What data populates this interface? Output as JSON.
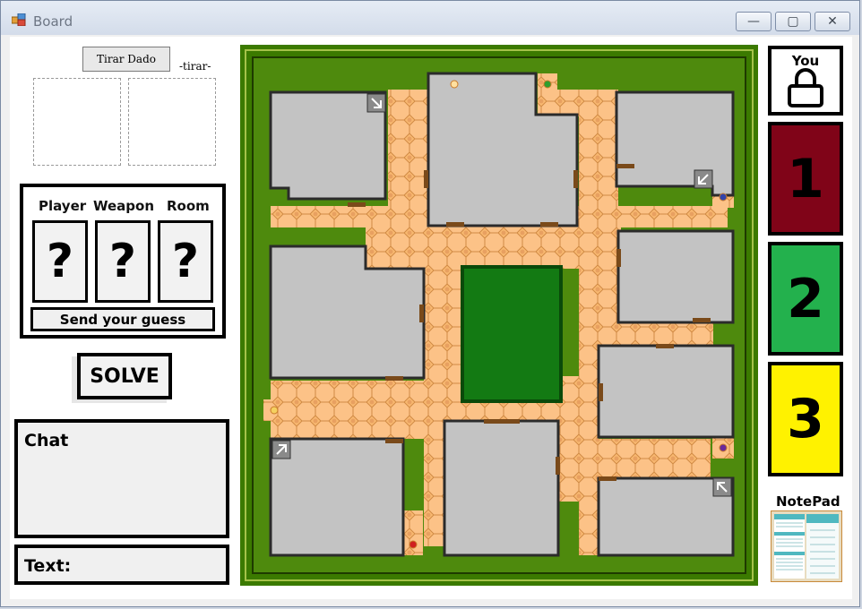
{
  "window": {
    "title": "Board",
    "minimize_glyph": "—",
    "maximize_glyph": "▢",
    "close_glyph": "✕"
  },
  "controls": {
    "roll_dice_label": "Tirar Dado",
    "roll_status": "-tirar-"
  },
  "guess": {
    "player_label": "Player",
    "weapon_label": "Weapon",
    "room_label": "Room",
    "card_placeholder": "?",
    "send_label": "Send your guess"
  },
  "solve": {
    "label": "SOLVE"
  },
  "chat": {
    "label": "Chat"
  },
  "text_input": {
    "label": "Text:"
  },
  "players": [
    {
      "label": "You",
      "icon": "lock-icon",
      "color": "#ffffff"
    },
    {
      "number": "1",
      "color": "#800418"
    },
    {
      "number": "2",
      "color": "#23b14d"
    },
    {
      "number": "3",
      "color": "#fff200"
    }
  ],
  "notepad": {
    "label": "NotePad",
    "icon": "notepad-icon"
  },
  "board": {
    "colors": {
      "outer": "#3b7a00",
      "inner": "#4e8a0d",
      "center": "#137a13",
      "corridor": "#f9b971",
      "room": "#c3c3c3",
      "wall": "#2b2b2b",
      "door": "#7a4a1a"
    },
    "secret_passage_icons": [
      "arrow-down-right-icon",
      "arrow-down-left-icon",
      "arrow-up-right-icon",
      "arrow-up-left-icon"
    ]
  }
}
